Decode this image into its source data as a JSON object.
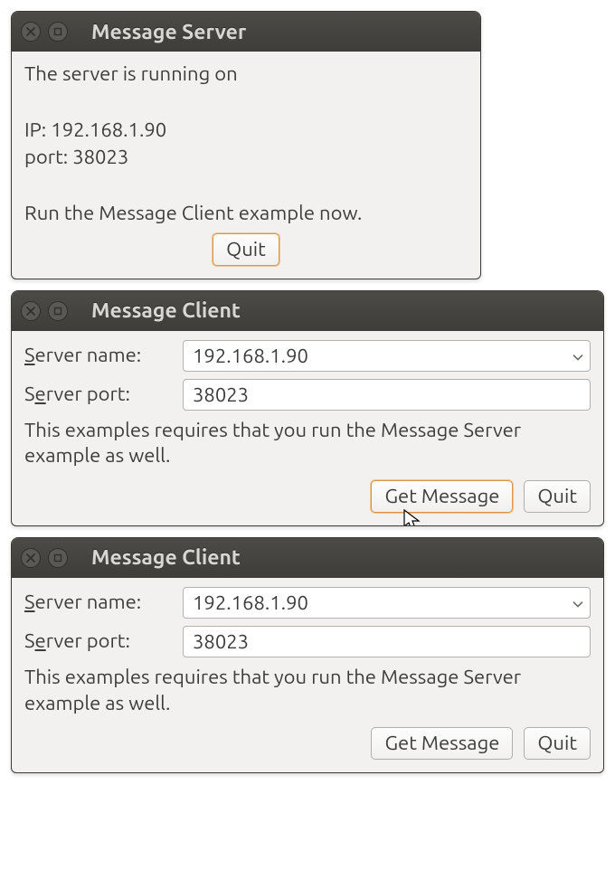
{
  "server_window": {
    "title": "Message Server",
    "body_line1": "The server is running on",
    "body_ip_label": "IP:",
    "body_ip_value": "192.168.1.90",
    "body_port_label": "port:",
    "body_port_value": "38023",
    "body_instruction": "Run the Message Client example now.",
    "quit_label": "Quit"
  },
  "client_window_1": {
    "title": "Message Client",
    "server_name_label_prefix": "S",
    "server_name_label_rest": "erver name:",
    "server_name_value": "192.168.1.90",
    "server_port_label_pre": "S",
    "server_port_label_mn": "e",
    "server_port_label_post": "rver port:",
    "server_port_value": "38023",
    "help_text": "This examples requires that you run the Message Server example as well.",
    "get_message_pre": "Get ",
    "get_message_mn": "M",
    "get_message_post": "essage",
    "quit_label": "Quit"
  },
  "client_window_2": {
    "title": "Message Client",
    "server_name_label_prefix": "S",
    "server_name_label_rest": "erver name:",
    "server_name_value": "192.168.1.90",
    "server_port_label_pre": "S",
    "server_port_label_mn": "e",
    "server_port_label_post": "rver port:",
    "server_port_value": "38023",
    "help_text": "This examples requires that you run the Message Server example as well.",
    "get_message_pre": "Get ",
    "get_message_mn": "M",
    "get_message_post": "essage",
    "quit_label": "Quit"
  }
}
